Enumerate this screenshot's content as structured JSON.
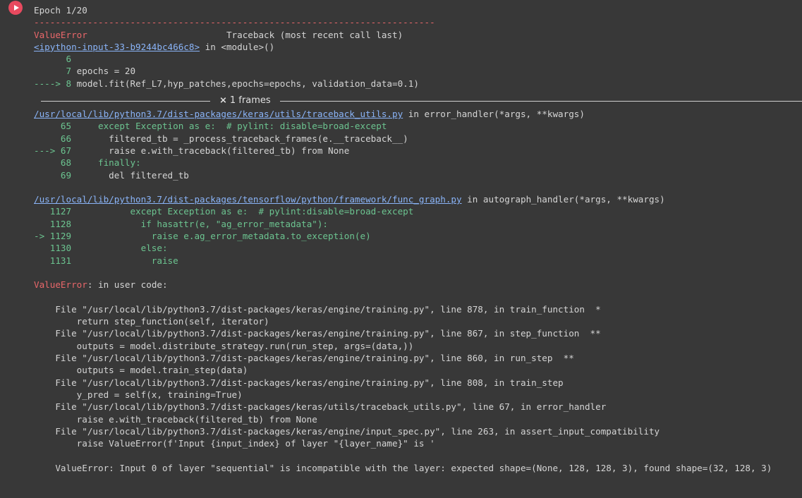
{
  "run_button": {
    "icon": "play-icon",
    "color": "#e84a5f"
  },
  "output": {
    "epoch_line": "Epoch 1/20",
    "separator": "---------------------------------------------------------------------------",
    "error_name": "ValueError",
    "traceback_header": "                          Traceback (most recent call last)",
    "frame0": {
      "file_link": "<ipython-input-33-b9244bc466c8>",
      "location": " in <module>()",
      "lines": [
        {
          "no": "      6",
          "code": ""
        },
        {
          "no": "      7",
          "code": " epochs = 20"
        },
        {
          "arrow": "----> 8",
          "code": " model.fit(Ref_L7,hyp_patches,epochs=epochs, validation_data=0.1)"
        }
      ]
    },
    "frames_toggle": {
      "label": "1 frames",
      "icon": "collapse-x-icon"
    },
    "frame1": {
      "file_link": "/usr/local/lib/python3.7/dist-packages/keras/utils/traceback_utils.py",
      "location": " in error_handler(*args, **kwargs)",
      "lines": [
        {
          "no": "     65",
          "code": "     except Exception as e:  # pylint: disable=broad-except"
        },
        {
          "no": "     66",
          "code": "       filtered_tb = _process_traceback_frames(e.__traceback__)"
        },
        {
          "no": "---> 67",
          "code": "       raise e.with_traceback(filtered_tb) from None"
        },
        {
          "no": "     68",
          "code": "     finally:"
        },
        {
          "no": "     69",
          "code": "       del filtered_tb"
        }
      ]
    },
    "frame2": {
      "file_link": "/usr/local/lib/python3.7/dist-packages/tensorflow/python/framework/func_graph.py",
      "location": " in autograph_handler(*args, **kwargs)",
      "lines": [
        {
          "no": "   1127",
          "code": "           except Exception as e:  # pylint:disable=broad-except"
        },
        {
          "no": "   1128",
          "code": "             if hasattr(e, \"ag_error_metadata\"):"
        },
        {
          "no": "-> 1129",
          "code": "               raise e.ag_error_metadata.to_exception(e)"
        },
        {
          "no": "   1130",
          "code": "             else:"
        },
        {
          "no": "   1131",
          "code": "               raise"
        }
      ]
    },
    "user_code_error": {
      "name": "ValueError",
      "rest": ": in user code:"
    },
    "user_trace": [
      "    File \"/usr/local/lib/python3.7/dist-packages/keras/engine/training.py\", line 878, in train_function  *",
      "        return step_function(self, iterator)",
      "    File \"/usr/local/lib/python3.7/dist-packages/keras/engine/training.py\", line 867, in step_function  **",
      "        outputs = model.distribute_strategy.run(run_step, args=(data,))",
      "    File \"/usr/local/lib/python3.7/dist-packages/keras/engine/training.py\", line 860, in run_step  **",
      "        outputs = model.train_step(data)",
      "    File \"/usr/local/lib/python3.7/dist-packages/keras/engine/training.py\", line 808, in train_step",
      "        y_pred = self(x, training=True)",
      "    File \"/usr/local/lib/python3.7/dist-packages/keras/utils/traceback_utils.py\", line 67, in error_handler",
      "        raise e.with_traceback(filtered_tb) from None",
      "    File \"/usr/local/lib/python3.7/dist-packages/keras/engine/input_spec.py\", line 263, in assert_input_compatibility",
      "        raise ValueError(f'Input {input_index} of layer \"{layer_name}\" is '"
    ],
    "final_error": "    ValueError: Input 0 of layer \"sequential\" is incompatible with the layer: expected shape=(None, 128, 128, 3), found shape=(32, 128, 3)"
  }
}
